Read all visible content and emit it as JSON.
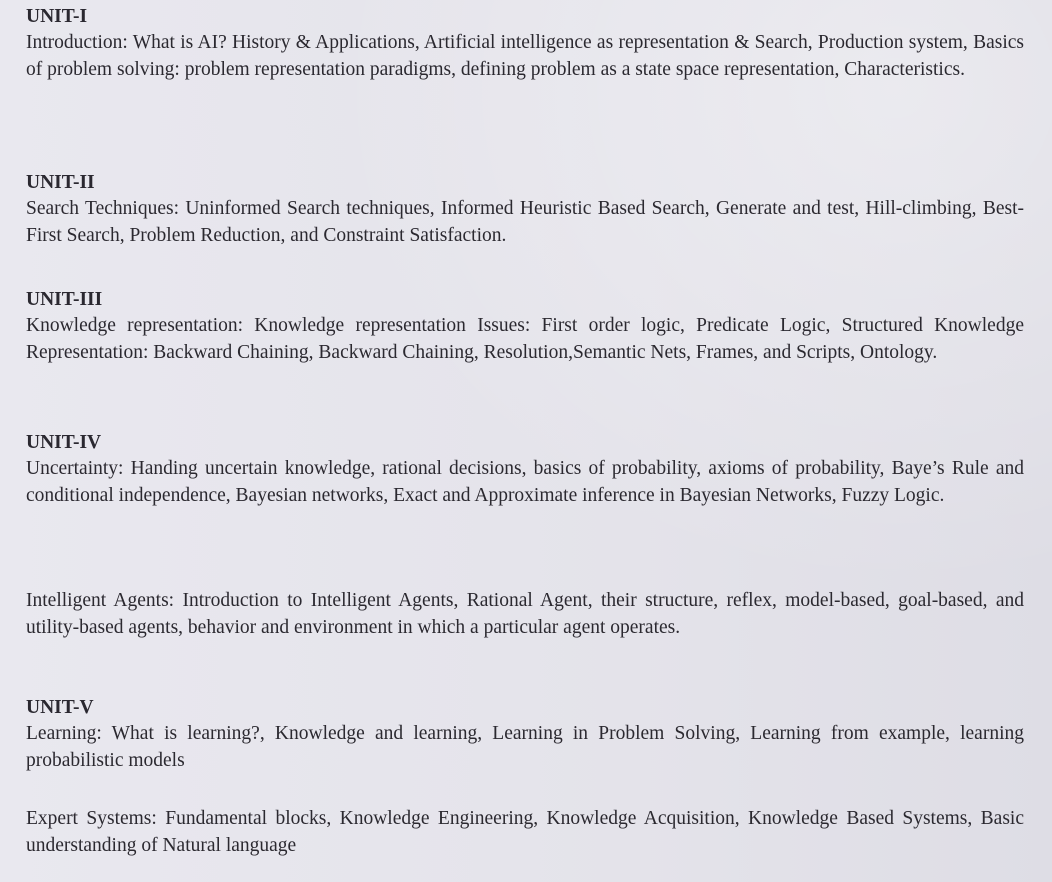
{
  "units": [
    {
      "heading": "UNIT-I",
      "text": "Introduction: What is AI? History & Applications, Artificial intelligence as representation & Search, Production system, Basics of problem solving: problem representation paradigms, defining problem as a state space representation, Characteristics."
    },
    {
      "heading": "UNIT-II",
      "text": "Search Techniques: Uninformed Search techniques, Informed Heuristic Based Search, Generate and test, Hill-climbing, Best-First Search, Problem Reduction, and Constraint Satisfaction."
    },
    {
      "heading": "UNIT-III",
      "text": "Knowledge representation: Knowledge representation Issues: First order logic, Predicate Logic, Structured Knowledge Representation: Backward Chaining, Backward Chaining, Resolution,Semantic Nets, Frames, and Scripts, Ontology."
    },
    {
      "heading": "UNIT-IV",
      "text": "Uncertainty: Handing uncertain knowledge, rational decisions, basics of probability, axioms of probability, Baye’s Rule and conditional independence, Bayesian networks, Exact and Approximate inference in Bayesian Networks, Fuzzy Logic."
    },
    {
      "heading": "UNIT-V",
      "text": "Learning: What is learning?, Knowledge and learning, Learning in Problem Solving, Learning from example, learning probabilistic models"
    }
  ],
  "intelligent_agents": "Intelligent Agents: Introduction to Intelligent Agents, Rational Agent, their structure, reflex, model-based, goal-based, and utility-based agents, behavior and environment in which a particular agent operates.",
  "expert_systems": "Expert Systems: Fundamental blocks, Knowledge Engineering, Knowledge Acquisition, Knowledge Based Systems, Basic understanding of Natural language"
}
